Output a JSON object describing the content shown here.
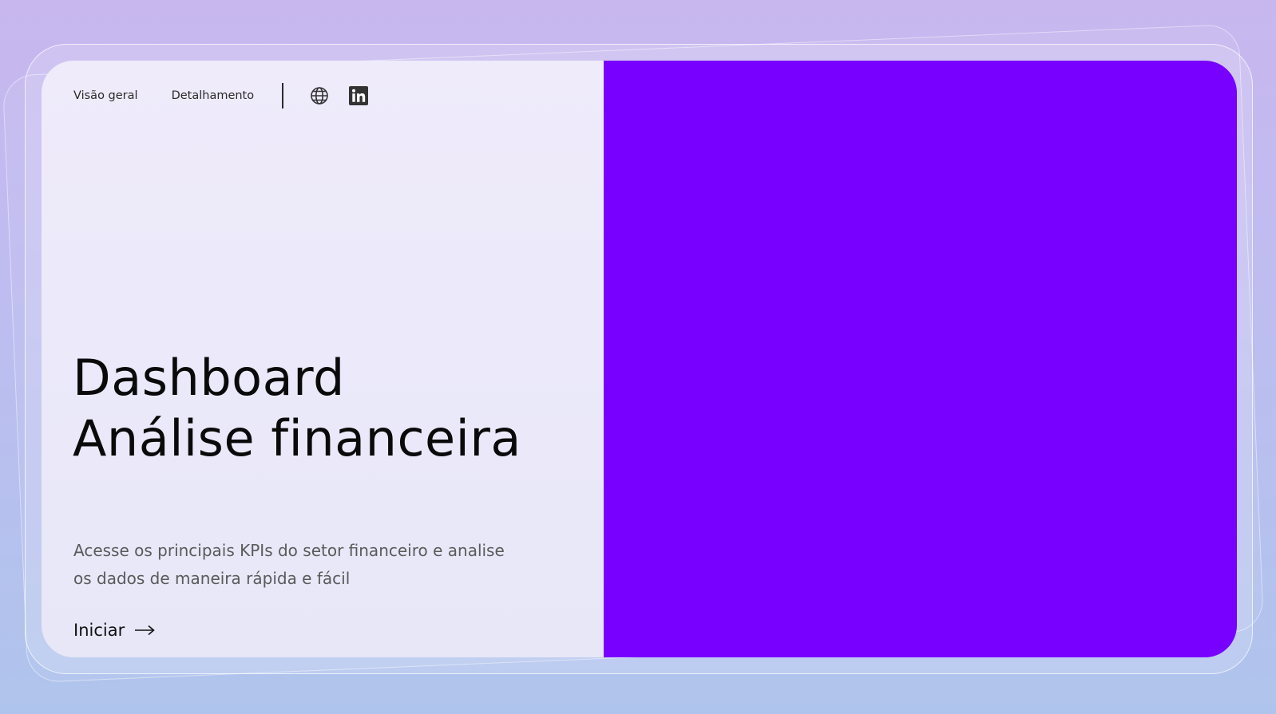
{
  "nav": {
    "links": [
      {
        "label": "Visão geral"
      },
      {
        "label": "Detalhamento"
      }
    ],
    "icons": [
      "globe-icon",
      "linkedin-icon"
    ]
  },
  "hero": {
    "title_line1": "Dashboard",
    "title_line2": "Análise financeira",
    "subtitle_line1": "Acesse os principais KPIs do setor financeiro e analise",
    "subtitle_line2": "os dados de maneira rápida e fácil",
    "cta_label": "Iniciar",
    "cta_icon": "arrow-right-icon"
  },
  "colors": {
    "accent_panel": "#7700ff",
    "text_primary": "#0a0a0a",
    "text_secondary": "#5a5a5a"
  }
}
